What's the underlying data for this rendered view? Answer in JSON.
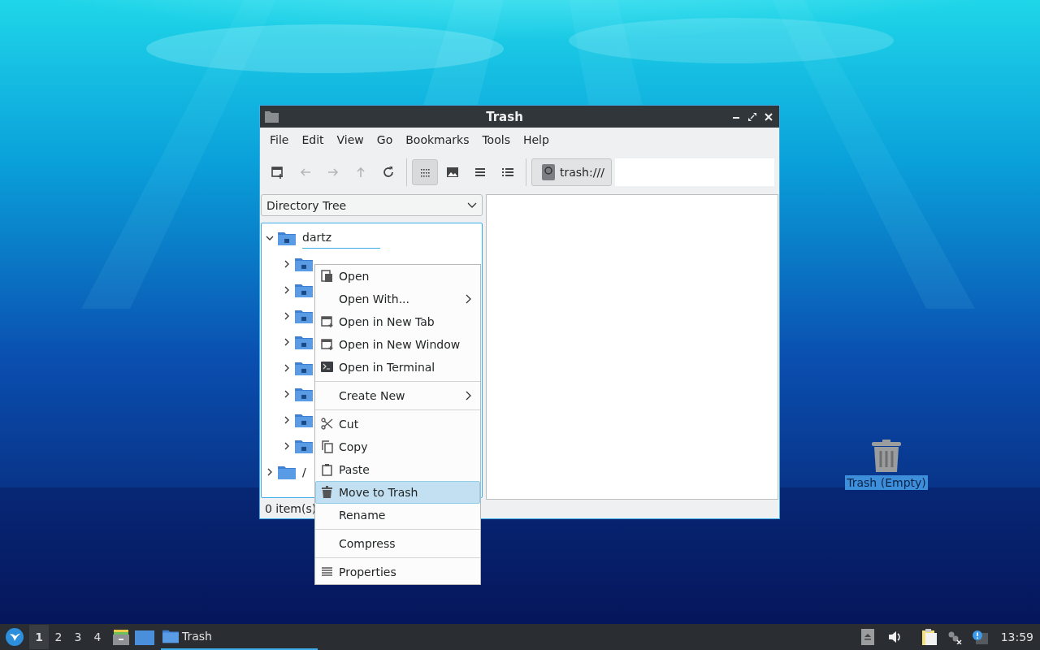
{
  "window": {
    "title": "Trash",
    "menubar": [
      "File",
      "Edit",
      "View",
      "Go",
      "Bookmarks",
      "Tools",
      "Help"
    ],
    "toolbar": {
      "nav": [
        {
          "disabled": false
        },
        {
          "disabled": true
        },
        {
          "disabled": true
        },
        {
          "disabled": true
        },
        {
          "disabled": false
        }
      ],
      "views": [
        {
          "selected": true
        },
        {
          "selected": false
        },
        {
          "selected": false
        },
        {
          "selected": false
        }
      ],
      "location": "trash:///"
    },
    "side_pane": {
      "mode": "Directory Tree",
      "tree": [
        {
          "label": "dartz",
          "expanded": true,
          "selected": true,
          "children": [
            {
              "expanded": false
            },
            {
              "expanded": false
            },
            {
              "expanded": false
            },
            {
              "expanded": false
            },
            {
              "expanded": false
            },
            {
              "expanded": false
            },
            {
              "expanded": false
            },
            {
              "expanded": false
            }
          ]
        },
        {
          "label": "/",
          "expanded": false
        }
      ]
    },
    "status_bar": "0 item(s)"
  },
  "context_menu": {
    "groups": [
      [
        {
          "label": "Open",
          "submenu": false,
          "selected": false
        },
        {
          "label": "Open With...",
          "submenu": true,
          "selected": false
        },
        {
          "label": "Open in New Tab",
          "submenu": false,
          "selected": false
        },
        {
          "label": "Open in New Window",
          "submenu": false,
          "selected": false
        },
        {
          "label": "Open in Terminal",
          "submenu": false,
          "selected": false
        }
      ],
      [
        {
          "label": "Create New",
          "submenu": true,
          "selected": false
        }
      ],
      [
        {
          "label": "Cut",
          "submenu": false,
          "selected": false
        },
        {
          "label": "Copy",
          "submenu": false,
          "selected": false
        },
        {
          "label": "Paste",
          "submenu": false,
          "selected": false
        },
        {
          "label": "Move to Trash",
          "submenu": false,
          "selected": true
        },
        {
          "label": "Rename",
          "submenu": false,
          "selected": false
        }
      ],
      [
        {
          "label": "Compress",
          "submenu": false,
          "selected": false
        }
      ],
      [
        {
          "label": "Properties",
          "submenu": false,
          "selected": false
        }
      ]
    ]
  },
  "desktop_icon": {
    "label": "Trash (Empty)",
    "selected": true
  },
  "taskbar": {
    "workspaces": [
      {
        "label": "1",
        "selected": true
      },
      {
        "label": "2",
        "selected": false
      },
      {
        "label": "3",
        "selected": false
      },
      {
        "label": "4",
        "selected": false
      }
    ],
    "tasks": [
      {
        "label": "Trash",
        "active": true
      }
    ],
    "clock": "13:59"
  }
}
